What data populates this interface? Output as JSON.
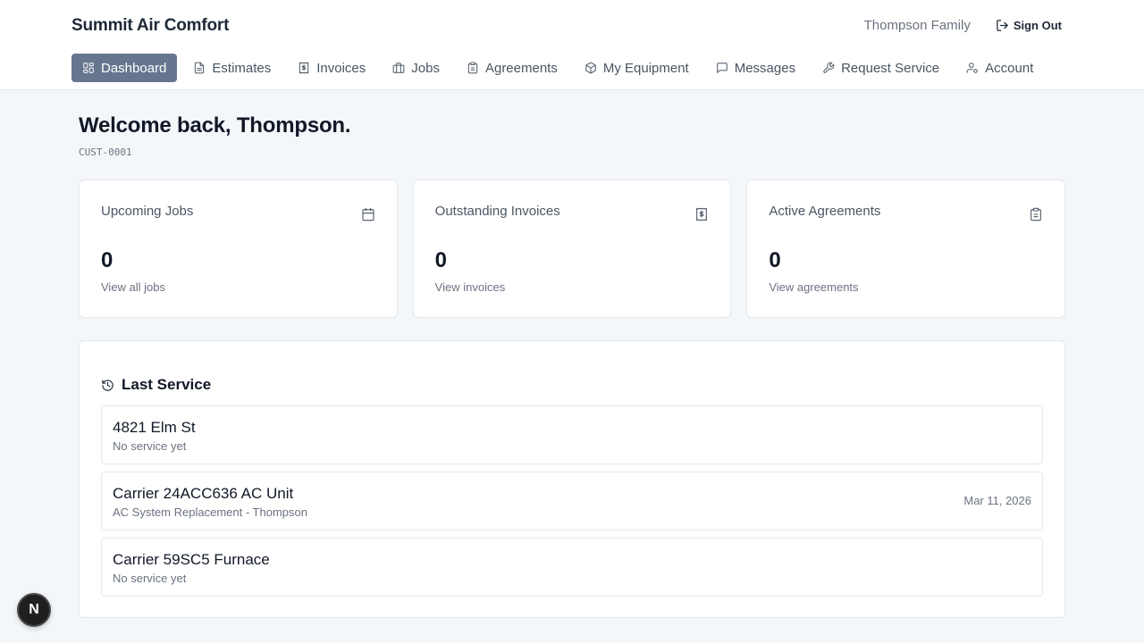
{
  "header": {
    "brand": "Summit Air Comfort",
    "user_name": "Thompson Family",
    "signout_label": "Sign Out"
  },
  "nav": {
    "items": [
      {
        "label": "Dashboard",
        "icon": "grid-icon",
        "active": true
      },
      {
        "label": "Estimates",
        "icon": "document-icon"
      },
      {
        "label": "Invoices",
        "icon": "receipt-dollar-icon"
      },
      {
        "label": "Jobs",
        "icon": "briefcase-icon"
      },
      {
        "label": "Agreements",
        "icon": "clipboard-icon"
      },
      {
        "label": "My Equipment",
        "icon": "box-icon"
      },
      {
        "label": "Messages",
        "icon": "message-icon"
      },
      {
        "label": "Request Service",
        "icon": "wrench-icon"
      },
      {
        "label": "Account",
        "icon": "user-settings-icon"
      }
    ]
  },
  "main": {
    "welcome": "Welcome back, Thompson.",
    "customer_id": "CUST-0001",
    "cards": [
      {
        "title": "Upcoming Jobs",
        "value": "0",
        "link": "View all jobs",
        "icon": "calendar-icon"
      },
      {
        "title": "Outstanding Invoices",
        "value": "0",
        "link": "View invoices",
        "icon": "receipt-dollar-icon"
      },
      {
        "title": "Active Agreements",
        "value": "0",
        "link": "View agreements",
        "icon": "clipboard-icon"
      }
    ],
    "last_service": {
      "title": "Last Service",
      "icon": "history-icon",
      "items": [
        {
          "name": "4821 Elm St",
          "sub": "No service yet",
          "date": ""
        },
        {
          "name": "Carrier 24ACC636 AC Unit",
          "sub": "AC System Replacement - Thompson",
          "date": "Mar 11, 2026"
        },
        {
          "name": "Carrier 59SC5 Furnace",
          "sub": "No service yet",
          "date": ""
        }
      ]
    }
  },
  "badge": {
    "label": "N"
  },
  "colors": {
    "accent": "#67768f",
    "background": "#f4f7fa",
    "text": "#1f2937",
    "muted": "#6b7280"
  }
}
